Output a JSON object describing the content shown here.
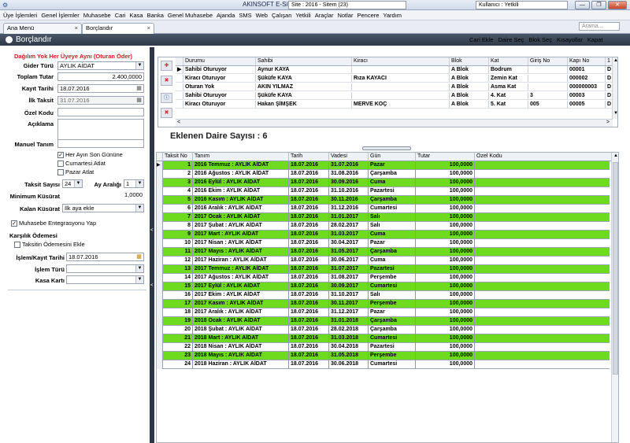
{
  "window": {
    "title": "AKINSOFT E-Site s",
    "site": "Site : 2016 - Sitem (23)",
    "user": "Kullanıcı : Yetkili",
    "minimize": "—",
    "restore": "❐",
    "close": "✕"
  },
  "menu": [
    "Üye İşlemleri",
    "Genel İşlemler",
    "Muhasebe",
    "Cari",
    "Kasa",
    "Banka",
    "Genel Muhasebe",
    "Ajanda",
    "SMS",
    "Web",
    "Çalışan",
    "Yetkili",
    "Araçlar",
    "Notlar",
    "Pencere",
    "Yardım"
  ],
  "search": {
    "placeholder": "Arama..."
  },
  "tabs": [
    {
      "label": "Ana Menü",
      "close": "×"
    },
    {
      "label": "Borçlandır",
      "close": "×"
    }
  ],
  "header": {
    "title": "Borçlandır"
  },
  "toolbar": [
    "Cari Ekle",
    "Daire Seç",
    "Blok Seç",
    "Kısayollar",
    "Kapat"
  ],
  "form": {
    "heading": "Dağılım Yok Her Üyeye Aynı (Oturan Öder)",
    "gider_turu": {
      "label": "Gider Türü",
      "value": "AYLIK AİDAT"
    },
    "toplam_tutar": {
      "label": "Toplam Tutar",
      "value": "2.400,0000"
    },
    "kayit_tarihi": {
      "label": "Kayıt Tarihi",
      "value": "18.07.2016"
    },
    "ilk_taksit": {
      "label": "İlk Taksit",
      "value": "31.07.2016"
    },
    "ozel_kodu": {
      "label": "Özel Kodu",
      "value": ""
    },
    "aciklama": {
      "label": "Açıklama",
      "value": ""
    },
    "manuel_tanim": {
      "label": "Manuel Tanım",
      "value": ""
    },
    "chk_son_gun": "Her Ayın Son Gününe",
    "chk_cumartesi": "Cumartesi Atlat",
    "chk_pazar": "Pazar Atlat",
    "taksit_sayisi": {
      "label": "Taksit Sayısı",
      "value": "24"
    },
    "ay_araligi": {
      "label": "Ay Aralığı",
      "value": "1"
    },
    "min_kusurat": {
      "label": "Minimum Küsürat",
      "value": "1,0000"
    },
    "kalan_kusurat": {
      "label": "Kalan Küsürat",
      "value": "İlk aya ekle"
    },
    "chk_muhasebe": "Muhasebe Entegrasyonu Yap",
    "karsilik_title": "Karşılık Ödemesi",
    "chk_taksit_odeme": "Taksitin Ödemesini Ekle",
    "islem_kayit_tarihi": {
      "label": "İşlem/Kayıt Tarihi",
      "value": "18.07.2016"
    },
    "islem_turu": {
      "label": "İşlem Türü",
      "value": ""
    },
    "kasa_karti": {
      "label": "Kasa Kartı",
      "value": ""
    }
  },
  "daireler": {
    "columns": [
      "Durumu",
      "Sahibi",
      "Kiracı",
      "Blok",
      "Kat",
      "Giriş No",
      "Kapı No",
      "1"
    ],
    "rows": [
      [
        "Sahibi Oturuyor",
        "Aynur KAYA",
        "",
        "A Blok",
        "Bodrum",
        "",
        "00001",
        "D"
      ],
      [
        "Kiracı Oturuyor",
        "Şüküfe KAYA",
        "Rıza KAYACI",
        "A Blok",
        "Zemin Kat",
        "",
        "000002",
        "D"
      ],
      [
        "Oturan Yok",
        "AKIN YILMAZ",
        "",
        "A Blok",
        "Asma Kat",
        "",
        "000000003",
        "D"
      ],
      [
        "Sahibi Oturuyor",
        "Şüküfe KAYA",
        "",
        "A Blok",
        "4. Kat",
        "3",
        "00003",
        "D"
      ],
      [
        "Kiracı Oturuyor",
        "Hakan ŞİMŞEK",
        "MERVE KOÇ",
        "A Blok",
        "5. Kat",
        "005",
        "00005",
        "D"
      ]
    ]
  },
  "eklenen": "Eklenen Daire Sayısı :   6",
  "taksitler": {
    "columns": [
      "Taksit No",
      "Tanım",
      "Tarih",
      "Vadesi",
      "Gün",
      "Tutar",
      "Özel Kodu"
    ],
    "rows": [
      [
        "1",
        "2016 Temmuz : AYLIK AİDAT",
        "18.07.2016",
        "31.07.2016",
        "Pazar",
        "100,0000",
        ""
      ],
      [
        "2",
        "2016 Ağustos : AYLIK AİDAT",
        "18.07.2016",
        "31.08.2016",
        "Çarşamba",
        "100,0000",
        ""
      ],
      [
        "3",
        "2016 Eylül : AYLIK AİDAT",
        "18.07.2016",
        "30.09.2016",
        "Cuma",
        "100,0000",
        ""
      ],
      [
        "4",
        "2016 Ekim : AYLIK AİDAT",
        "18.07.2016",
        "31.10.2016",
        "Pazartesi",
        "100,0000",
        ""
      ],
      [
        "5",
        "2016 Kasım : AYLIK AİDAT",
        "18.07.2016",
        "30.11.2016",
        "Çarşamba",
        "100,0000",
        ""
      ],
      [
        "6",
        "2016 Aralık : AYLIK AİDAT",
        "18.07.2016",
        "31.12.2016",
        "Cumartesi",
        "100,0000",
        ""
      ],
      [
        "7",
        "2017 Ocak : AYLIK AİDAT",
        "18.07.2016",
        "31.01.2017",
        "Salı",
        "100,0000",
        ""
      ],
      [
        "8",
        "2017 Şubat : AYLIK AİDAT",
        "18.07.2016",
        "28.02.2017",
        "Salı",
        "100,0000",
        ""
      ],
      [
        "9",
        "2017 Mart : AYLIK AİDAT",
        "18.07.2016",
        "31.03.2017",
        "Cuma",
        "100,0000",
        ""
      ],
      [
        "10",
        "2017 Nisan : AYLIK AİDAT",
        "18.07.2016",
        "30.04.2017",
        "Pazar",
        "100,0000",
        ""
      ],
      [
        "11",
        "2017 Mayıs : AYLIK AİDAT",
        "18.07.2016",
        "31.05.2017",
        "Çarşamba",
        "100,0000",
        ""
      ],
      [
        "12",
        "2017 Haziran : AYLIK AİDAT",
        "18.07.2016",
        "30.06.2017",
        "Cuma",
        "100,0000",
        ""
      ],
      [
        "13",
        "2017 Temmuz : AYLIK AİDAT",
        "18.07.2016",
        "31.07.2017",
        "Pazartesi",
        "100,0000",
        ""
      ],
      [
        "14",
        "2017 Ağustos : AYLIK AİDAT",
        "18.07.2016",
        "31.08.2017",
        "Perşembe",
        "100,0000",
        ""
      ],
      [
        "15",
        "2017 Eylül : AYLIK AİDAT",
        "18.07.2016",
        "30.09.2017",
        "Cumartesi",
        "100,0000",
        ""
      ],
      [
        "16",
        "2017 Ekim : AYLIK AİDAT",
        "18.07.2016",
        "31.10.2017",
        "Salı",
        "100,0000",
        ""
      ],
      [
        "17",
        "2017 Kasım : AYLIK AİDAT",
        "18.07.2016",
        "30.11.2017",
        "Perşembe",
        "100,0000",
        ""
      ],
      [
        "18",
        "2017 Aralık : AYLIK AİDAT",
        "18.07.2016",
        "31.12.2017",
        "Pazar",
        "100,0000",
        ""
      ],
      [
        "19",
        "2018 Ocak : AYLIK AİDAT",
        "18.07.2016",
        "31.01.2018",
        "Çarşamba",
        "100,0000",
        ""
      ],
      [
        "20",
        "2018 Şubat : AYLIK AİDAT",
        "18.07.2016",
        "28.02.2018",
        "Çarşamba",
        "100,0000",
        ""
      ],
      [
        "21",
        "2018 Mart : AYLIK AİDAT",
        "18.07.2016",
        "31.03.2018",
        "Cumartesi",
        "100,0000",
        ""
      ],
      [
        "22",
        "2018 Nisan : AYLIK AİDAT",
        "18.07.2016",
        "30.04.2018",
        "Pazartesi",
        "100,0000",
        ""
      ],
      [
        "23",
        "2018 Mayıs : AYLIK AİDAT",
        "18.07.2016",
        "31.05.2018",
        "Perşembe",
        "100,0000",
        ""
      ],
      [
        "24",
        "2018 Haziran : AYLIK AİDAT",
        "18.07.2016",
        "30.06.2018",
        "Cumartesi",
        "100,0000",
        ""
      ]
    ]
  },
  "colors": {
    "green_row": "#6edb1e",
    "header_band": "#2f3947",
    "heading_red": "#cc1c1c"
  }
}
